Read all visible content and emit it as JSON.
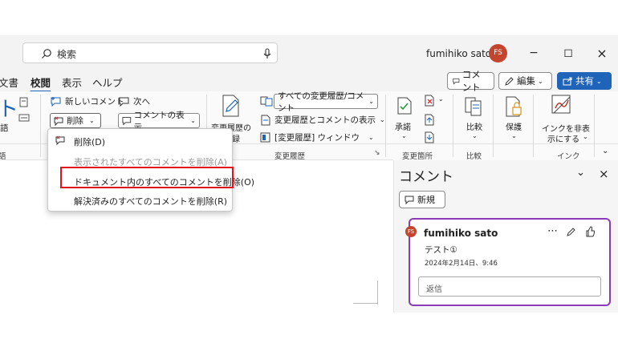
{
  "titlebar": {
    "search_placeholder": "検索",
    "user_name": "fumihiko sato",
    "user_initials": "FS",
    "minimize": "−",
    "restore": "◻",
    "close": "×"
  },
  "tabs": {
    "cut_left": "文書",
    "review": "校閲",
    "view": "表示",
    "help": "ヘルプ",
    "comment_btn": "コメント",
    "edit_btn": "編集",
    "share_btn": "共有"
  },
  "ribbon": {
    "new_comment": "新しいコメント",
    "next": "次へ",
    "delete": "削除",
    "show_comments": "コメントの表示",
    "left_cut_text": "ト",
    "left_cut_label": "語",
    "left_cut_group": "語",
    "track_changes": "変更履歴の",
    "track_changes_2": "録",
    "all_markup": "すべての変更履歴/コメント",
    "show_markup": "変更履歴とコメントの表示",
    "reviewing_pane": "[変更履歴] ウィンドウ",
    "group_tracking": "変更履歴",
    "accept": "承諾",
    "group_changes": "変更箇所",
    "compare": "比較",
    "group_compare": "比較",
    "protect": "保護",
    "hide_ink": "インクを非表",
    "hide_ink_2": "示にする",
    "group_ink": "インク"
  },
  "menu": {
    "delete": "削除(D)",
    "delete_shown": "表示されたすべてのコメントを削除(A)",
    "delete_all": "ドキュメント内のすべてのコメントを削除(O)",
    "delete_resolved": "解決済みのすべてのコメントを削除(R)"
  },
  "pane": {
    "title": "コメント",
    "new_btn": "新規",
    "collapse": "⌄",
    "close": "×"
  },
  "comment": {
    "author": "fumihiko sato",
    "initials": "FS",
    "text": "テスト①",
    "date": "2024年2月14日、9:46",
    "reply_placeholder": "返信",
    "more": "⋯"
  }
}
